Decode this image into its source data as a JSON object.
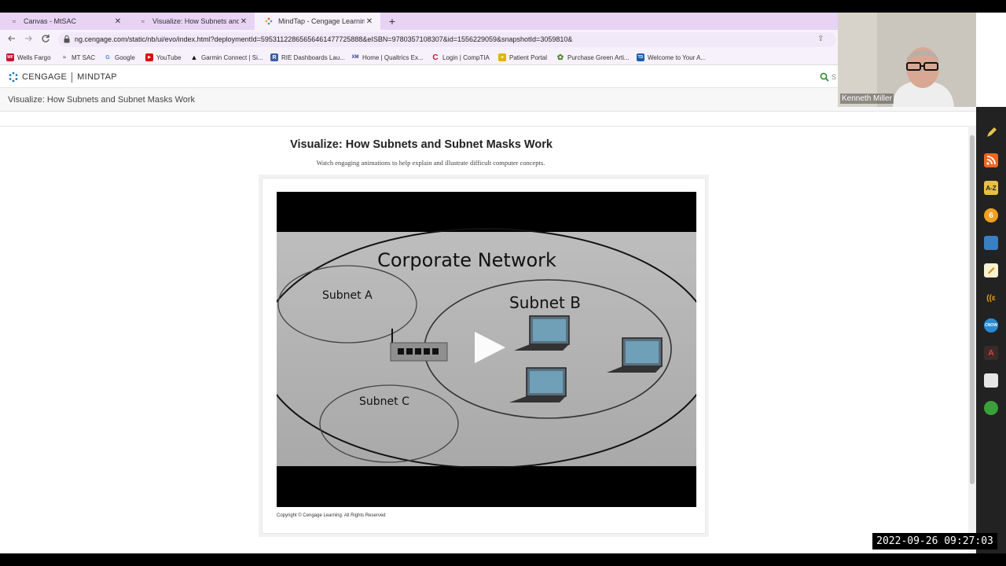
{
  "tabs": [
    {
      "label": "Canvas - MtSAC",
      "close": "✕"
    },
    {
      "label": "Visualize: How Subnets and Subn",
      "close": "✕"
    },
    {
      "label": "MindTap - Cengage Learning",
      "close": "✕"
    }
  ],
  "new_tab": "+",
  "address": {
    "url": "ng.cengage.com/static/nb/ui/evo/index.html?deploymentId=59531122865656461477725888&eISBN=9780357108307&id=1556229059&snapshotId=3059810&"
  },
  "bookmarks": [
    {
      "label": "Wells Fargo",
      "icon": "WF",
      "color": "#c8102e"
    },
    {
      "label": "MT SAC",
      "icon": "≈",
      "color": "#555555"
    },
    {
      "label": "Google",
      "icon": "G",
      "color": "#4285f4"
    },
    {
      "label": "YouTube",
      "icon": "▶",
      "color": "#e00000"
    },
    {
      "label": "Garmin Connect | Si...",
      "icon": "▲",
      "color": "#111111"
    },
    {
      "label": "RIE Dashboards Lau...",
      "icon": "R",
      "color": "#3a5fa0"
    },
    {
      "label": "Home | Qualtrics Ex...",
      "icon": "XM",
      "color": "#2c3e8c"
    },
    {
      "label": "Login | CompTIA",
      "icon": "C",
      "color": "#c8102e"
    },
    {
      "label": "Patient Portal",
      "icon": "+",
      "color": "#e0b400"
    },
    {
      "label": "Purchase Green Arti...",
      "icon": "✿",
      "color": "#4a8a2a"
    },
    {
      "label": "Welcome to Your A...",
      "icon": "TD",
      "color": "#1a5fa8"
    }
  ],
  "app": {
    "brand": "CENGAGE",
    "product": "MINDTAP",
    "search_placeholder": "S"
  },
  "breadcrumb": "Visualize: How Subnets and Subnet Masks Work",
  "content": {
    "title": "Visualize: How Subnets and Subnet Masks Work",
    "subtitle": "Watch engaging animations to help explain and illustrate difficult computer concepts.",
    "copyright": "Copyright © Cengage Learning. All Rights Reserved"
  },
  "video": {
    "network_label": "Corporate Network",
    "subnet_a": "Subnet A",
    "subnet_b": "Subnet B",
    "subnet_c": "Subnet C"
  },
  "webcam": {
    "name": "Kenneth Miller"
  },
  "timestamp": "2022-09-26  09:27:03",
  "colors": {
    "tab_strip": "#e8d3f5",
    "brand_blue": "#1b75bb"
  }
}
